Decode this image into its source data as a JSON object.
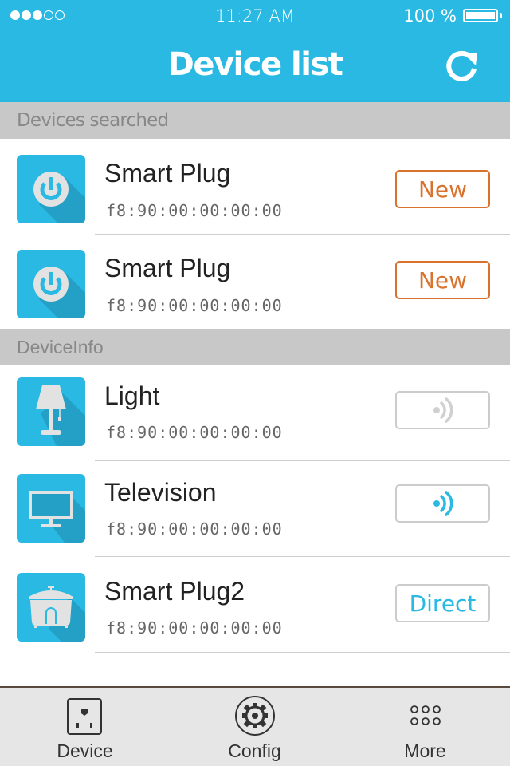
{
  "status_bar": {
    "signal_filled": 3,
    "signal_total": 5,
    "time": "11:27 AM",
    "battery_percent_label": "100 %",
    "battery_level": 1.0
  },
  "header": {
    "title": "Device list",
    "refresh_icon": "refresh-icon"
  },
  "colors": {
    "brand": "#29b9e3",
    "new_badge": "#d9722c",
    "section_bg": "#c8c8c8",
    "inactive_signal": "#d0d0d0"
  },
  "sections": [
    {
      "title": "Devices searched",
      "devices": [
        {
          "name": "Smart Plug",
          "mac": "f8:90:00:00:00:00",
          "icon": "power-icon",
          "action": {
            "type": "new",
            "label": "New"
          }
        },
        {
          "name": "Smart Plug",
          "mac": "f8:90:00:00:00:00",
          "icon": "power-icon",
          "action": {
            "type": "new",
            "label": "New"
          }
        }
      ]
    },
    {
      "title": "DeviceInfo",
      "devices": [
        {
          "name": "Light",
          "mac": "f8:90:00:00:00:00",
          "icon": "lamp-icon",
          "action": {
            "type": "signal",
            "state": "inactive",
            "icon": "wifi-signal-icon"
          }
        },
        {
          "name": "Television",
          "mac": "f8:90:00:00:00:00",
          "icon": "television-icon",
          "action": {
            "type": "signal",
            "state": "active",
            "icon": "wifi-signal-icon"
          }
        },
        {
          "name": "Smart Plug2",
          "mac": "f8:90:00:00:00:00",
          "icon": "rice-cooker-icon",
          "action": {
            "type": "direct",
            "label": "Direct"
          }
        }
      ]
    }
  ],
  "tabbar": {
    "tabs": [
      {
        "label": "Device",
        "icon": "outlet-icon"
      },
      {
        "label": "Config",
        "icon": "gear-icon"
      },
      {
        "label": "More",
        "icon": "more-dots-icon"
      }
    ]
  }
}
